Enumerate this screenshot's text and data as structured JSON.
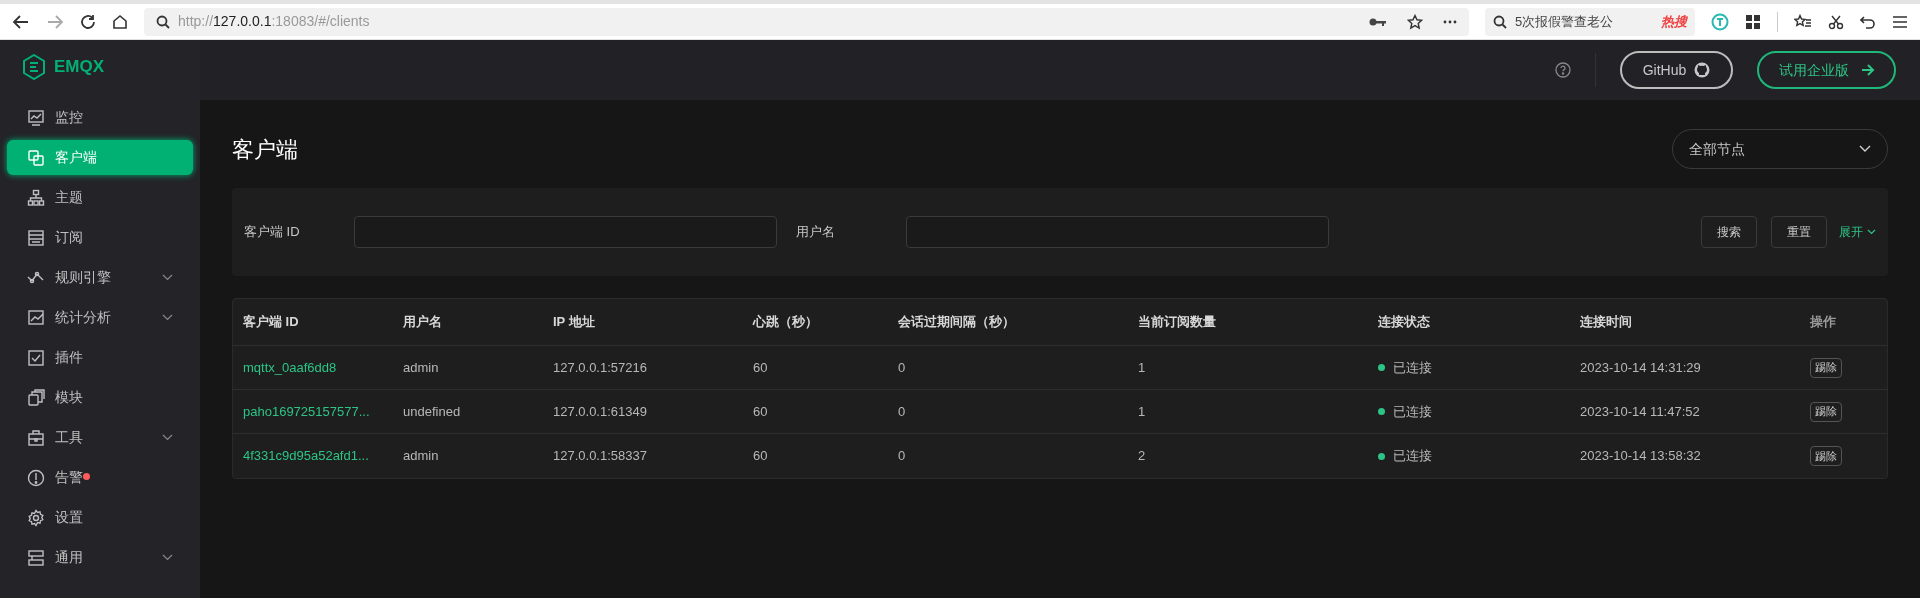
{
  "browser": {
    "url_prefix": "http://",
    "url_host": "127.0.0.1",
    "url_rest": ":18083/#/clients",
    "search_text": "5次报假警查老公",
    "hot_badge": "热搜"
  },
  "sidebar": {
    "logo": "EMQX",
    "items": [
      {
        "label": "监控",
        "selected": false,
        "expandable": false,
        "alert": false
      },
      {
        "label": "客户端",
        "selected": true,
        "expandable": false,
        "alert": false
      },
      {
        "label": "主题",
        "selected": false,
        "expandable": false,
        "alert": false
      },
      {
        "label": "订阅",
        "selected": false,
        "expandable": false,
        "alert": false
      },
      {
        "label": "规则引擎",
        "selected": false,
        "expandable": true,
        "alert": false
      },
      {
        "label": "统计分析",
        "selected": false,
        "expandable": true,
        "alert": false
      },
      {
        "label": "插件",
        "selected": false,
        "expandable": false,
        "alert": false
      },
      {
        "label": "模块",
        "selected": false,
        "expandable": false,
        "alert": false
      },
      {
        "label": "工具",
        "selected": false,
        "expandable": true,
        "alert": false
      },
      {
        "label": "告警",
        "selected": false,
        "expandable": false,
        "alert": true
      },
      {
        "label": "设置",
        "selected": false,
        "expandable": false,
        "alert": false
      },
      {
        "label": "通用",
        "selected": false,
        "expandable": true,
        "alert": false
      }
    ]
  },
  "header": {
    "github": "GitHub",
    "enterprise": "试用企业版"
  },
  "page": {
    "title": "客户端",
    "node_select": "全部节点"
  },
  "filters": {
    "fields": [
      {
        "label": "客户端 ID"
      },
      {
        "label": "用户名"
      }
    ],
    "search": "搜索",
    "reset": "重置",
    "expand": "展开"
  },
  "table": {
    "columns": [
      "客户端 ID",
      "用户名",
      "IP 地址",
      "心跳（秒）",
      "会话过期间隔（秒）",
      "当前订阅数量",
      "连接状态",
      "连接时间",
      "操作"
    ],
    "rows": [
      {
        "client_id": "mqttx_0aaf6dd8",
        "username": "admin",
        "ip": "127.0.0.1:57216",
        "keepalive": "60",
        "expiry": "0",
        "subscriptions": "1",
        "connected": true,
        "status": "已连接",
        "connected_at": "2023-10-14 14:31:29",
        "action": "踢除"
      },
      {
        "client_id": "paho169725157577...",
        "username": "undefined",
        "ip": "127.0.0.1:61349",
        "keepalive": "60",
        "expiry": "0",
        "subscriptions": "1",
        "connected": true,
        "status": "已连接",
        "connected_at": "2023-10-14 11:47:52",
        "action": "踢除"
      },
      {
        "client_id": "4f331c9d95a52afd1...",
        "username": "admin",
        "ip": "127.0.0.1:58337",
        "keepalive": "60",
        "expiry": "0",
        "subscriptions": "2",
        "connected": true,
        "status": "已连接",
        "connected_at": "2023-10-14 13:58:32",
        "action": "踢除"
      }
    ]
  }
}
